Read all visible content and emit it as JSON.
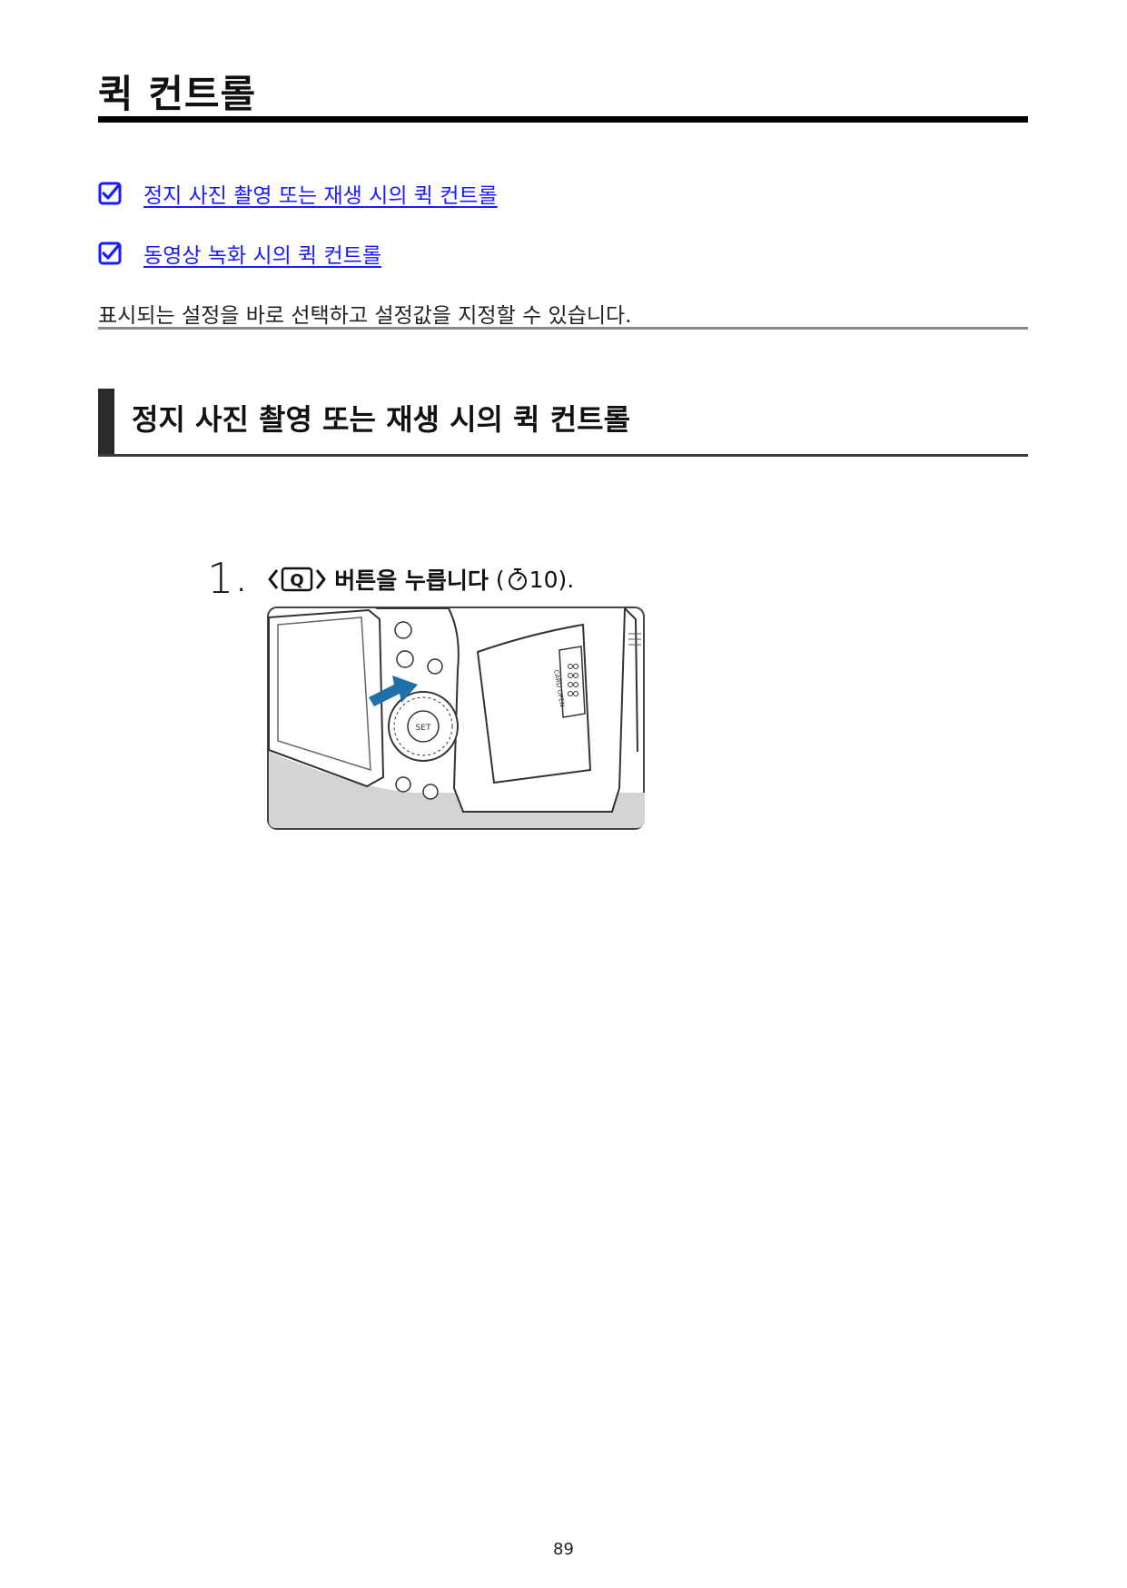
{
  "page": {
    "title": "퀵 컨트롤",
    "intro": "표시되는 설정을 바로 선택하고 설정값을 지정할 수 있습니다.",
    "page_number": "89"
  },
  "toc": [
    {
      "label": "정지 사진 촬영 또는 재생 시의 퀵 컨트롤",
      "icon": "checkbox-link-icon"
    },
    {
      "label": "동영상 녹화 시의 퀵 컨트롤",
      "icon": "checkbox-link-icon"
    }
  ],
  "section": {
    "title": "정지 사진 촬영 또는 재생 시의 퀵 컨트롤"
  },
  "step1": {
    "number": "1",
    "dot": ".",
    "button_icon": "q-button-icon",
    "button_letter": "Q",
    "text": "버튼을 누릅니다",
    "ref_open": "(",
    "ref_icon": "timer-icon",
    "ref_value": "10",
    "ref_close": ")."
  },
  "figure": {
    "description_icon": "camera-back-illustration",
    "set_label": "SET",
    "card_label": "CARD OPEN",
    "arrow_color": "#1f6fa8"
  },
  "colors": {
    "link": "#1a1aff",
    "rule": "#000000"
  }
}
